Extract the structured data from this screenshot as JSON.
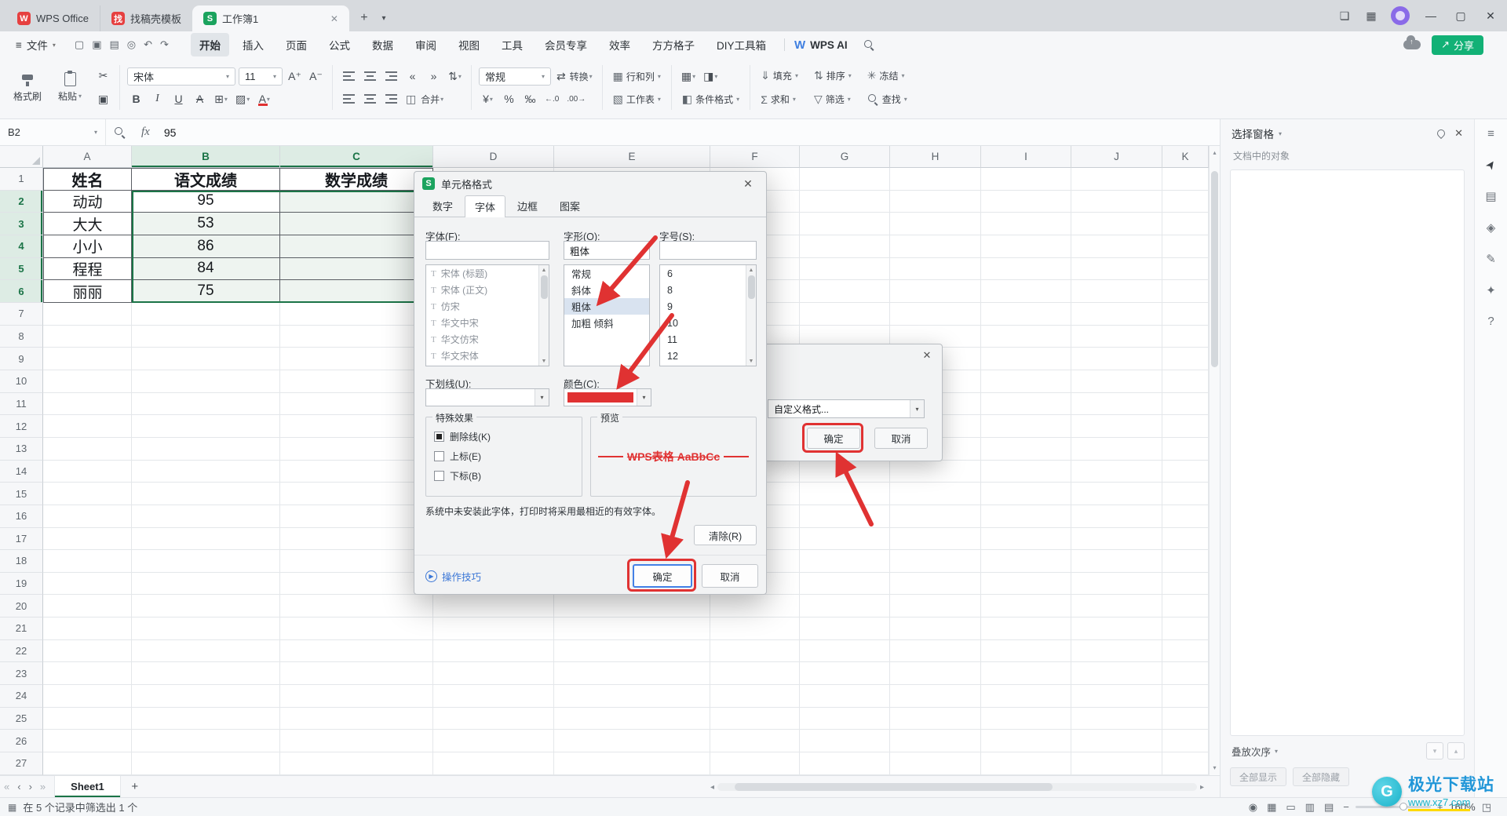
{
  "titlebar": {
    "app_tab_label": "WPS Office",
    "template_tab_label": "找稿壳模板",
    "doc_tab_label": "工作簿1"
  },
  "menubar": {
    "file_label": "文件",
    "tabs": [
      "开始",
      "插入",
      "页面",
      "公式",
      "数据",
      "审阅",
      "视图",
      "工具",
      "会员专享",
      "效率",
      "方方格子",
      "DIY工具箱"
    ],
    "active_tab": "开始",
    "wps_ai_label": "WPS AI",
    "share_label": "分享"
  },
  "ribbon": {
    "format_painter_label": "格式刷",
    "paste_label": "粘贴",
    "font_family_value": "宋体",
    "font_size_value": "11",
    "number_format_value": "常规",
    "convert_label": "转换",
    "merge_label": "合并",
    "rows_cols_label": "行和列",
    "worksheet_label": "工作表",
    "conditional_format_label": "条件格式",
    "fill_label": "填充",
    "sort_label": "排序",
    "freeze_label": "冻结",
    "sum_label": "求和",
    "filter_label": "筛选",
    "find_label": "查找"
  },
  "formula_bar": {
    "cell_ref": "B2",
    "fx_label": "fx",
    "value": "95"
  },
  "grid": {
    "columns": [
      "A",
      "B",
      "C",
      "D",
      "E",
      "F",
      "G",
      "H",
      "I",
      "J",
      "K"
    ],
    "row_count": 27,
    "active_cell": "B2",
    "selection": "B2:C6"
  },
  "sheet_data": {
    "header_row": [
      "姓名",
      "语文成绩",
      "数学成绩"
    ],
    "data_rows": [
      [
        "动动",
        "95",
        ""
      ],
      [
        "大大",
        "53",
        ""
      ],
      [
        "小小",
        "86",
        ""
      ],
      [
        "程程",
        "84",
        ""
      ],
      [
        "丽丽",
        "75",
        ""
      ]
    ]
  },
  "format_dialog": {
    "title": "单元格格式",
    "tabs": [
      "数字",
      "字体",
      "边框",
      "图案"
    ],
    "active_tab": "字体",
    "font_label": "字体(F):",
    "style_label": "字形(O):",
    "size_label": "字号(S):",
    "font_input_value": "",
    "style_input_value": "粗体",
    "size_input_value": "",
    "font_list": [
      "宋体 (标题)",
      "宋体 (正文)",
      "仿宋",
      "华文中宋",
      "华文仿宋",
      "华文宋体"
    ],
    "style_list": [
      "常规",
      "斜体",
      "粗体",
      "加粗 倾斜"
    ],
    "style_selected": "粗体",
    "size_list": [
      "6",
      "8",
      "9",
      "10",
      "11",
      "12"
    ],
    "underline_label": "下划线(U):",
    "color_label": "颜色(C):",
    "effects_title": "特殊效果",
    "effects": [
      {
        "label": "删除线(K)",
        "checked": true
      },
      {
        "label": "上标(E)",
        "checked": false
      },
      {
        "label": "下标(B)",
        "checked": false
      }
    ],
    "preview_title": "预览",
    "preview_text": "WPS表格  AaBbCc",
    "note": "系统中未安装此字体，打印时将采用最相近的有效字体。",
    "clear_label": "清除(R)",
    "tips_label": "操作技巧",
    "ok_label": "确定",
    "cancel_label": "取消"
  },
  "filter_dialog": {
    "dropdown_value": "自定义格式...",
    "ok_label": "确定",
    "cancel_label": "取消"
  },
  "selection_pane": {
    "title": "选择窗格",
    "objects_label": "文档中的对象",
    "stack_order_label": "叠放次序",
    "show_all_label": "全部显示",
    "hide_all_label": "全部隐藏"
  },
  "sheet_bar": {
    "sheet_name": "Sheet1"
  },
  "status_bar": {
    "left_text": "在 5 个记录中筛选出 1 个",
    "zoom_value": "160%"
  },
  "watermark": {
    "site_name": "极光下载站",
    "site_url": "www.xz7.com"
  },
  "icons": {
    "quick_access": [
      {
        "name": "new-file-icon",
        "glyph": "▢"
      },
      {
        "name": "save-icon",
        "glyph": "▣"
      },
      {
        "name": "print-icon",
        "glyph": "▤"
      },
      {
        "name": "print-preview-icon",
        "glyph": "◎"
      },
      {
        "name": "undo-icon",
        "glyph": "↶"
      },
      {
        "name": "redo-icon",
        "glyph": "↷"
      }
    ],
    "side_strip": [
      {
        "name": "collapse-panel-icon",
        "glyph": "≡"
      },
      {
        "name": "select-cursor-icon",
        "glyph": "➤"
      },
      {
        "name": "layout-icon",
        "glyph": "▤"
      },
      {
        "name": "chart-tool-icon",
        "glyph": "◈"
      },
      {
        "name": "edit-tool-icon",
        "glyph": "✎"
      },
      {
        "name": "star-tool-icon",
        "glyph": "✦"
      },
      {
        "name": "help-icon",
        "glyph": "?"
      }
    ],
    "status_right": [
      {
        "name": "record-icon",
        "glyph": "◉"
      },
      {
        "name": "table-icon",
        "glyph": "▦"
      },
      {
        "name": "normal-view-icon",
        "glyph": "▭"
      },
      {
        "name": "page-layout-view-icon",
        "glyph": "▥"
      },
      {
        "name": "page-break-view-icon",
        "glyph": "▤"
      }
    ]
  },
  "colors": {
    "accent_green": "#1b7447",
    "selection_tint": "#eef4f0",
    "header_sel_bg": "#ddece4",
    "annotation_red": "#e03232",
    "preview_red": "#e03232",
    "swatch_red": "#e03232",
    "focus_blue": "#4381e6",
    "share_teal": "#12b176",
    "brand_red": "#e64040",
    "ai_blue": "#3f7fe0",
    "avatar_purple": "#8a6ae8",
    "watermark_blue": "#2196d8",
    "watermark_teal": "#19b2c9",
    "watermark_yellow": "#ffd900",
    "link_blue": "#3a76d6",
    "sheet_logo_green": "#1ba35e"
  }
}
